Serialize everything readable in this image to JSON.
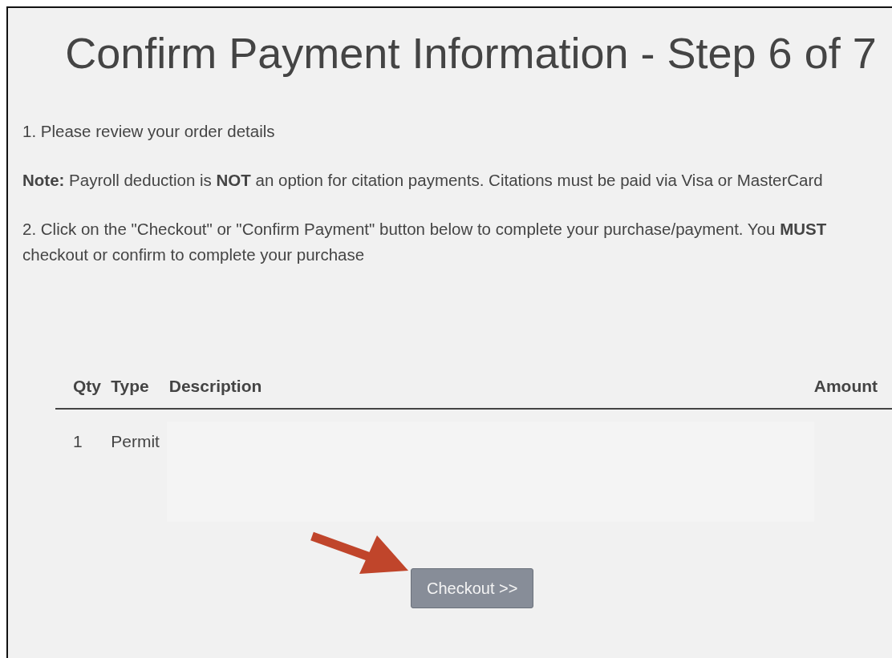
{
  "title": "Confirm Payment Information - Step 6 of 7",
  "instructions": [
    "1. Please review your order details",
    "**Note:** Payroll deduction is **NOT** an option for citation payments. Citations must be paid via Visa or MasterCard",
    "2. Click on the \"Checkout\" or \"Confirm Payment\" button below to complete your purchase/payment. You **MUST** checkout or confirm to complete your purchase"
  ],
  "table": {
    "columns": [
      "Qty",
      "Type",
      "Description",
      "Amount"
    ],
    "rows": [
      {
        "cells": [
          "1",
          "Permit"
        ]
      }
    ]
  },
  "checkout_button": "Checkout >>"
}
